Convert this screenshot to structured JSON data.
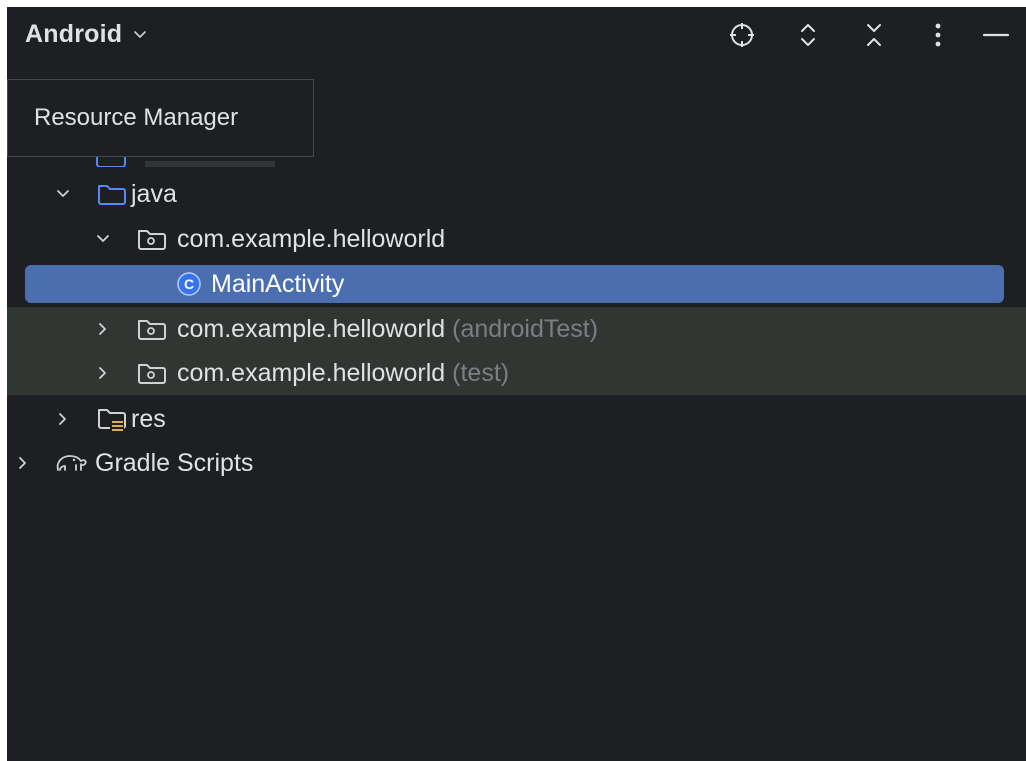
{
  "header": {
    "view_title": "Android",
    "toolbar_icons": [
      "locate-icon",
      "expand-all-icon",
      "collapse-all-icon",
      "more-options-icon",
      "minimize-icon"
    ]
  },
  "tooltip": {
    "text": "Resource Manager"
  },
  "tree": {
    "java": {
      "label": "java",
      "expanded": true
    },
    "package_main": {
      "label": "com.example.helloworld",
      "expanded": true
    },
    "main_activity": {
      "label": "MainActivity",
      "badge": "C",
      "selected": true
    },
    "package_android_test": {
      "label": "com.example.helloworld",
      "qualifier": "(androidTest)",
      "expanded": false
    },
    "package_test": {
      "label": "com.example.helloworld",
      "qualifier": "(test)",
      "expanded": false
    },
    "res": {
      "label": "res",
      "expanded": false
    },
    "gradle_scripts": {
      "label": "Gradle Scripts",
      "expanded": false
    }
  },
  "colors": {
    "background": "#1e1f22",
    "selection": "#4b6eaf",
    "context_highlight": "#323633",
    "folder_blue": "#548af7",
    "muted_text": "#7a7e85",
    "resource_yellow": "#d6ae58"
  }
}
